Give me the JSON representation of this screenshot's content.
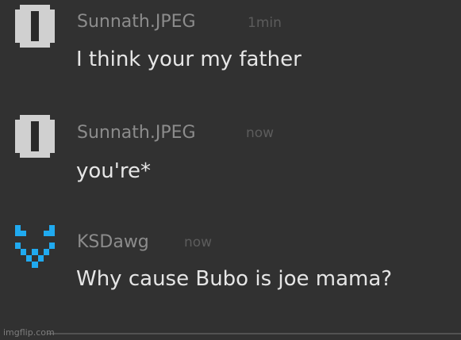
{
  "messages": [
    {
      "username": "Sunnath.JPEG",
      "time": "1min",
      "text": "I think your my father",
      "avatar_icon": "gray-pixel-ghost-icon"
    },
    {
      "username": "Sunnath.JPEG",
      "time": "now",
      "text": "you're*",
      "avatar_icon": "gray-pixel-ghost-icon"
    },
    {
      "username": "KSDawg",
      "time": "now",
      "text": "Why cause Bubo is joe mama?",
      "avatar_icon": "cyan-pixel-face-icon"
    }
  ],
  "colors": {
    "background": "#313131",
    "username": "#8c8c8c",
    "timestamp": "#5c5c5c",
    "message_text": "#e6e6e6",
    "gray_avatar": "#d0d0d0",
    "cyan_avatar": "#20aaf0"
  },
  "watermark": "imgflip.com"
}
